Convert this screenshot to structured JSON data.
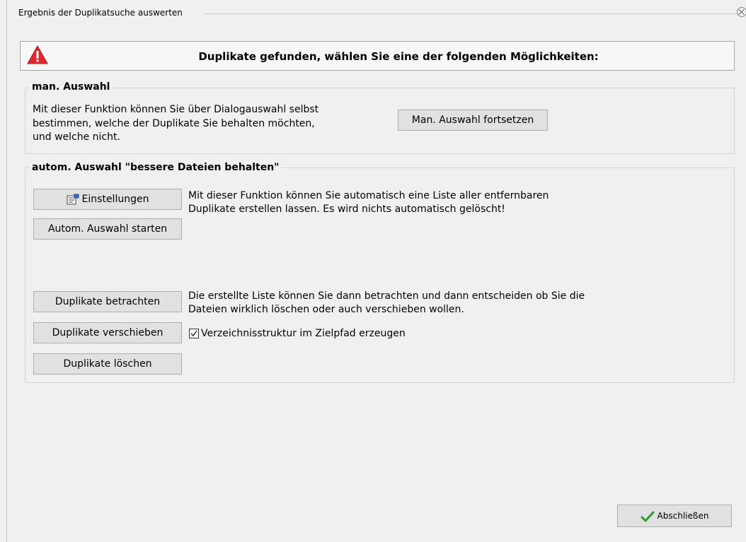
{
  "window": {
    "title": "Ergebnis der Duplikatsuche auswerten"
  },
  "banner": {
    "message": "Duplikate gefunden, wählen Sie eine der folgenden Möglichkeiten:"
  },
  "manual": {
    "title": "man. Auswahl",
    "description_lines": [
      "Mit dieser Funktion können Sie über Dialogauswahl selbst",
      "bestimmen, welche der Duplikate Sie behalten möchten,",
      "und welche nicht."
    ],
    "continue_button": "Man. Auswahl fortsetzen"
  },
  "auto": {
    "title": "autom. Auswahl \"bessere Dateien behalten\"",
    "settings_button": "Einstellungen",
    "start_button": "Autom. Auswahl starten",
    "description_lines": [
      "Mit dieser Funktion können Sie automatisch eine Liste aller  entfernbaren",
      "Duplikate erstellen lassen. Es wird nichts automatisch gelöscht!"
    ],
    "view_button": "Duplikate betrachten",
    "move_button": "Duplikate verschieben",
    "delete_button": "Duplikate löschen",
    "list_lines": [
      "Die erstellte Liste können Sie dann betrachten und dann entscheiden ob Sie die",
      "Dateien wirklich löschen oder auch verschieben wollen."
    ],
    "structure_checkbox": {
      "label": "Verzeichnisstruktur im Zielpfad erzeugen",
      "checked": true
    }
  },
  "footer": {
    "finish_button": "Abschließen"
  },
  "colors": {
    "warning_red": "#e0282e",
    "check_green": "#2e9b2e"
  }
}
